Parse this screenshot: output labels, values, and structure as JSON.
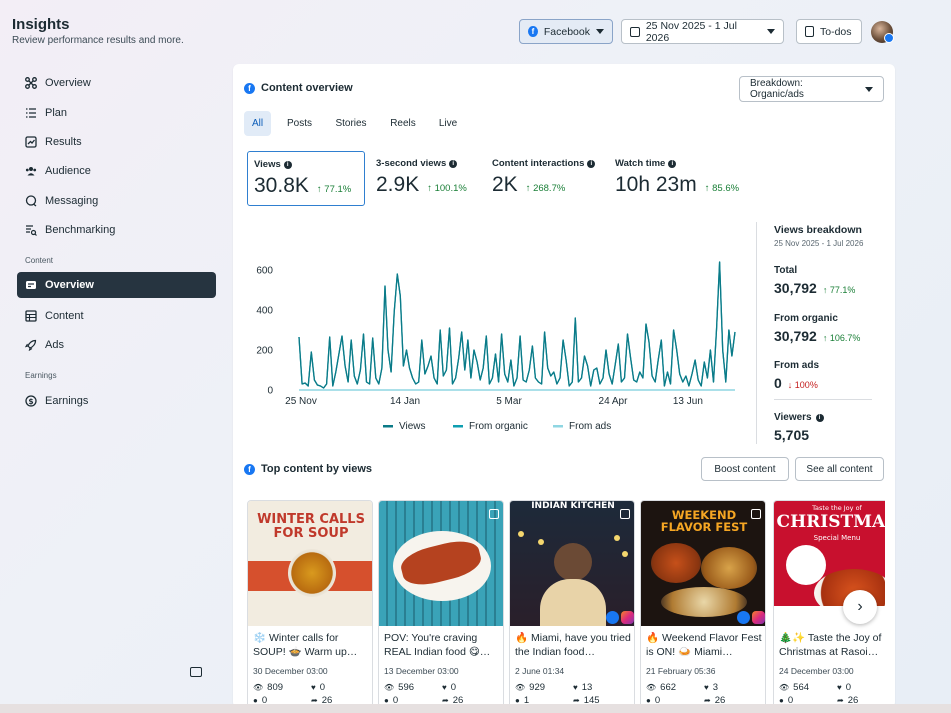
{
  "header": {
    "title": "Insights",
    "subtitle": "Review performance results and more.",
    "platform_label": "Facebook",
    "date_range": "25 Nov 2025 - 1 Jul 2026",
    "todos_label": "To-dos"
  },
  "sidebar": {
    "items": [
      {
        "label": "Overview",
        "icon": "nodes-icon"
      },
      {
        "label": "Plan",
        "icon": "list-icon"
      },
      {
        "label": "Results",
        "icon": "trend-icon"
      },
      {
        "label": "Audience",
        "icon": "people-icon"
      },
      {
        "label": "Messaging",
        "icon": "chat-icon"
      },
      {
        "label": "Benchmarking",
        "icon": "compare-icon"
      }
    ],
    "content_section": "Content",
    "content_items": [
      {
        "label": "Overview",
        "icon": "card-icon",
        "active": true
      },
      {
        "label": "Content",
        "icon": "grid-icon"
      },
      {
        "label": "Ads",
        "icon": "rocket-icon"
      }
    ],
    "earnings_section": "Earnings",
    "earnings_items": [
      {
        "label": "Earnings",
        "icon": "dollar-icon"
      }
    ]
  },
  "content_overview": {
    "title": "Content overview",
    "breakdown_label": "Breakdown: Organic/ads",
    "tabs": [
      "All",
      "Posts",
      "Stories",
      "Reels",
      "Live"
    ],
    "active_tab": "All",
    "metrics": [
      {
        "label": "Views",
        "value": "30.8K",
        "change": "↑ 77.1%"
      },
      {
        "label": "3-second views",
        "value": "2.9K",
        "change": "↑ 100.1%"
      },
      {
        "label": "Content interactions",
        "value": "2K",
        "change": "↑ 268.7%"
      },
      {
        "label": "Watch time",
        "value": "10h 23m",
        "change": "↑ 85.6%"
      }
    ]
  },
  "chart_data": {
    "type": "line",
    "title": "",
    "xlabel": "",
    "ylabel": "",
    "ylim": [
      0,
      700
    ],
    "yticks": [
      0,
      200,
      400,
      600
    ],
    "xticks": [
      "25 Nov",
      "14 Jan",
      "5 Mar",
      "24 Apr",
      "13 Jun"
    ],
    "legend_placement": "bottom",
    "grid": false,
    "series": [
      {
        "name": "Views",
        "color": "#0b7a87",
        "values": [
          265,
          30,
          35,
          20,
          190,
          50,
          25,
          20,
          10,
          30,
          265,
          20,
          90,
          180,
          270,
          120,
          40,
          250,
          70,
          30,
          100,
          280,
          40,
          30,
          260,
          60,
          30,
          110,
          520,
          200,
          90,
          390,
          580,
          470,
          120,
          200,
          110,
          60,
          30,
          40,
          250,
          80,
          120,
          170,
          60,
          30,
          300,
          70,
          100,
          310,
          30,
          60,
          160,
          290,
          100,
          250,
          60,
          200,
          140,
          50,
          110,
          270,
          30,
          60,
          180,
          40,
          280,
          80,
          40,
          150,
          20,
          60,
          270,
          50,
          40,
          100,
          220,
          60,
          40,
          30,
          290,
          110,
          70,
          90,
          30,
          60,
          250,
          150,
          20,
          40,
          360,
          40,
          60,
          170,
          120,
          20,
          100,
          110,
          30,
          60,
          200,
          80,
          30,
          130,
          230,
          40,
          60,
          280,
          160,
          50,
          40,
          90,
          60,
          330,
          240,
          70,
          40,
          150,
          250,
          20,
          90,
          30,
          300,
          200,
          80,
          40,
          70,
          20,
          80,
          150,
          50,
          20,
          140,
          60,
          200,
          40,
          310,
          640,
          200,
          40,
          300,
          170,
          290
        ]
      },
      {
        "name": "From organic",
        "color": "#0e9eb0",
        "values": [
          265,
          30,
          35,
          20,
          190,
          50,
          25,
          20,
          10,
          30,
          265,
          20,
          90,
          180,
          270,
          120,
          40,
          250,
          70,
          30,
          100,
          280,
          40,
          30,
          260,
          60,
          30,
          110,
          520,
          200,
          90,
          390,
          580,
          470,
          120,
          200,
          110,
          60,
          30,
          40,
          250,
          80,
          120,
          170,
          60,
          30,
          300,
          70,
          100,
          310,
          30,
          60,
          160,
          290,
          100,
          250,
          60,
          200,
          140,
          50,
          110,
          270,
          30,
          60,
          180,
          40,
          280,
          80,
          40,
          150,
          20,
          60,
          270,
          50,
          40,
          100,
          220,
          60,
          40,
          30,
          290,
          110,
          70,
          90,
          30,
          60,
          250,
          150,
          20,
          40,
          360,
          40,
          60,
          170,
          120,
          20,
          100,
          110,
          30,
          60,
          200,
          80,
          30,
          130,
          230,
          40,
          60,
          280,
          160,
          50,
          40,
          90,
          60,
          330,
          240,
          70,
          40,
          150,
          250,
          20,
          90,
          30,
          300,
          200,
          80,
          40,
          70,
          20,
          80,
          150,
          50,
          20,
          140,
          60,
          200,
          40,
          310,
          640,
          200,
          40,
          300,
          170,
          290
        ]
      },
      {
        "name": "From ads",
        "color": "#8fd6e2",
        "values": [
          0,
          0,
          0,
          0,
          0,
          0,
          0,
          0,
          0,
          0,
          0,
          0,
          0,
          0,
          0,
          0,
          0,
          0,
          0,
          0,
          0,
          0,
          0,
          0,
          0,
          0,
          0,
          0,
          0,
          0,
          0,
          0,
          0,
          0,
          0,
          0,
          0,
          0,
          0,
          0,
          0,
          0,
          0,
          0,
          0,
          0,
          0,
          0,
          0,
          0,
          0,
          0,
          0,
          0,
          0,
          0,
          0,
          0,
          0,
          0,
          0,
          0,
          0,
          0,
          0,
          0,
          0,
          0,
          0,
          0,
          0,
          0,
          0,
          0,
          0,
          0,
          0,
          0,
          0,
          0,
          0,
          0,
          0,
          0,
          0,
          0,
          0,
          0,
          0,
          0,
          0,
          0,
          0,
          0,
          0,
          0,
          0,
          0,
          0,
          0,
          0,
          0,
          0,
          0,
          0,
          0,
          0,
          0,
          0,
          0,
          0,
          0,
          0,
          0,
          0,
          0,
          0,
          0,
          0,
          0,
          0,
          0,
          0,
          0,
          0,
          0,
          0,
          0,
          0,
          0,
          0,
          0,
          0,
          0,
          0,
          0,
          0,
          0,
          0,
          0,
          0,
          0,
          0
        ]
      }
    ]
  },
  "views_breakdown": {
    "title": "Views breakdown",
    "date_range": "25 Nov 2025 - 1 Jul 2026",
    "total_label": "Total",
    "total_value": "30,792",
    "total_change": "↑ 77.1%",
    "organic_label": "From organic",
    "organic_value": "30,792",
    "organic_change": "↑ 106.7%",
    "ads_label": "From ads",
    "ads_value": "0",
    "ads_change": "↓ 100%",
    "viewers_label": "Viewers",
    "viewers_value": "5,705"
  },
  "top_content": {
    "title": "Top content by views",
    "boost_label": "Boost content",
    "see_all_label": "See all content",
    "posts": [
      {
        "caption": "❄️ Winter calls for SOUP! 🍲 Warm up…",
        "date": "30 December 03:00",
        "views": "809",
        "likes": "0",
        "comments": "0",
        "shares": "26",
        "img_text1": "WINTER CALLS",
        "img_text2": "FOR SOUP"
      },
      {
        "caption": "POV: You're craving REAL Indian food 😋…",
        "date": "13 December 03:00",
        "views": "596",
        "likes": "0",
        "comments": "0",
        "shares": "26"
      },
      {
        "caption": "🔥 Miami, have you tried the Indian food…",
        "date": "2 June 01:34",
        "views": "929",
        "likes": "13",
        "comments": "1",
        "shares": "145",
        "img_text1": "INDIAN KITCHEN"
      },
      {
        "caption": "🔥 Weekend Flavor Fest is ON! 🍛 Miami…",
        "date": "21 February 05:36",
        "views": "662",
        "likes": "3",
        "comments": "0",
        "shares": "26",
        "img_text1": "WEEKEND",
        "img_text2": "FLAVOR FEST"
      },
      {
        "caption": "🎄✨ Taste the Joy of Christmas at Rasoi…",
        "date": "24 December 03:00",
        "views": "564",
        "likes": "0",
        "comments": "0",
        "shares": "26",
        "img_text1": "Taste the Joy of",
        "img_text2": "CHRISTMAS",
        "img_text3": "Special Menu"
      }
    ]
  },
  "colors": {
    "active_nav": "#263440",
    "accent_blue": "#1877f2",
    "positive": "#1a7f37",
    "negative": "#c41e1e"
  }
}
